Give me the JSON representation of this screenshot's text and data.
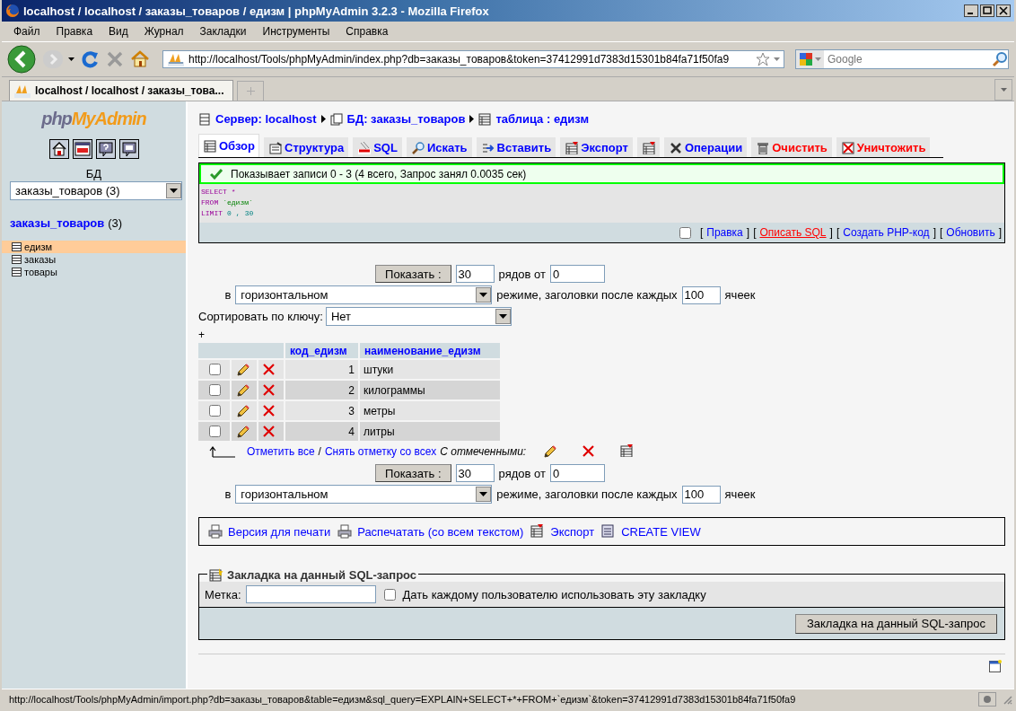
{
  "window": {
    "title": "localhost / localhost / заказы_товаров / едизм | phpMyAdmin 3.2.3 - Mozilla Firefox"
  },
  "menu": [
    "Файл",
    "Правка",
    "Вид",
    "Журнал",
    "Закладки",
    "Инструменты",
    "Справка"
  ],
  "navbar": {
    "url": "http://localhost/Tools/phpMyAdmin/index.php?db=заказы_товаров&token=37412991d7383d15301b84fa71f50fa9",
    "search_placeholder": "Google"
  },
  "browser_tabs": [
    {
      "label": "localhost / localhost / заказы_това...",
      "selected": true
    }
  ],
  "sidebar": {
    "logo": [
      "php",
      "MyAdmin"
    ],
    "db_label": "БД",
    "db_select": "заказы_товаров (3)",
    "db_link": "заказы_товаров",
    "db_count": "(3)",
    "tables": [
      {
        "name": "едизм",
        "selected": true
      },
      {
        "name": "заказы",
        "selected": false
      },
      {
        "name": "товары",
        "selected": false
      }
    ]
  },
  "breadcrumb": [
    "Сервер: localhost",
    "БД: заказы_товаров",
    "таблица : едизм"
  ],
  "tabs": [
    {
      "label": "Обзор",
      "selected": true,
      "danger": false
    },
    {
      "label": "Структура",
      "selected": false,
      "danger": false
    },
    {
      "label": "SQL",
      "selected": false,
      "danger": false
    },
    {
      "label": "Искать",
      "selected": false,
      "danger": false
    },
    {
      "label": "Вставить",
      "selected": false,
      "danger": false
    },
    {
      "label": "Экспорт",
      "selected": false,
      "danger": false
    },
    {
      "selected": false
    },
    {
      "label": "Операции",
      "selected": false,
      "danger": false
    },
    {
      "label": "Очистить",
      "selected": false,
      "danger": true
    },
    {
      "label": "Уничтожить",
      "selected": false,
      "danger": true
    }
  ],
  "message": "Показывает записи 0 - 3 (4 всего, Запрос занял 0.0035 сек)",
  "sql": [
    [
      {
        "text": "SELECT",
        "kind": "keyword"
      },
      {
        "text": "*",
        "kind": "keyword"
      }
    ],
    [
      {
        "text": "FROM",
        "kind": "keyword"
      },
      {
        "text": "`едизм`",
        "kind": "ident"
      }
    ],
    [
      {
        "text": "LIMIT",
        "kind": "keyword"
      },
      {
        "text": "0",
        "kind": "number"
      },
      {
        "text": ",",
        "kind": "number"
      },
      {
        "text": "30",
        "kind": "number"
      }
    ]
  ],
  "sql_actions": {
    "checked": false,
    "links": [
      {
        "open": "[",
        "label": "Правка",
        "close": "]",
        "hover": false
      },
      {
        "open": "[",
        "label": "Описать SQL",
        "close": "]",
        "hover": true
      },
      {
        "open": "[",
        "label": "Создать PHP-код",
        "close": "]",
        "hover": false
      },
      {
        "open": "[",
        "label": "Обновить",
        "close": "]",
        "hover": false
      }
    ]
  },
  "nav_forms": [
    {
      "button": "Показать :",
      "rows": "30",
      "rows_label": "рядов от",
      "start": "0",
      "in_label": "в",
      "mode": "горизонтальном",
      "mode_label": "режиме, заголовки после каждых",
      "repeat": "100",
      "cells_label": "ячеек"
    },
    {
      "button": "Показать :",
      "rows": "30",
      "rows_label": "рядов от",
      "start": "0",
      "in_label": "в",
      "mode": "горизонтальном",
      "mode_label": "режиме, заголовки после каждых",
      "repeat": "100",
      "cells_label": "ячеек"
    }
  ],
  "sort": {
    "label": "Сортировать по ключу:",
    "value": "Нет"
  },
  "plus": "+",
  "table": {
    "columns": [
      "код_едизм",
      "наименование_едизм"
    ],
    "rows": [
      {
        "checked": false,
        "cells": [
          "1",
          "штуки"
        ]
      },
      {
        "checked": false,
        "cells": [
          "2",
          "килограммы"
        ]
      },
      {
        "checked": false,
        "cells": [
          "3",
          "метры"
        ]
      },
      {
        "checked": false,
        "cells": [
          "4",
          "литры"
        ]
      }
    ]
  },
  "bulk": {
    "check_all": "Отметить все",
    "slash": "/",
    "uncheck_all": "Снять отметку со всех",
    "with_selected": "С отмеченными:"
  },
  "print_links": [
    "Версия для печати",
    "Распечатать (со всем текстом)",
    "Экспорт",
    "CREATE VIEW"
  ],
  "bookmark": {
    "legend": "Закладка на данный SQL-запрос",
    "label": "Метка:",
    "share_label": "Дать каждому пользователю использовать эту закладку",
    "share_checked": false,
    "button": "Закладка на данный SQL-запрос"
  },
  "status_bar": "http://localhost/Tools/phpMyAdmin/import.php?db=заказы_товаров&table=едизм&sql_query=EXPLAIN+SELECT+*+FROM+`едизм`&token=37412991d7383d15301b84fa71f50fa9"
}
